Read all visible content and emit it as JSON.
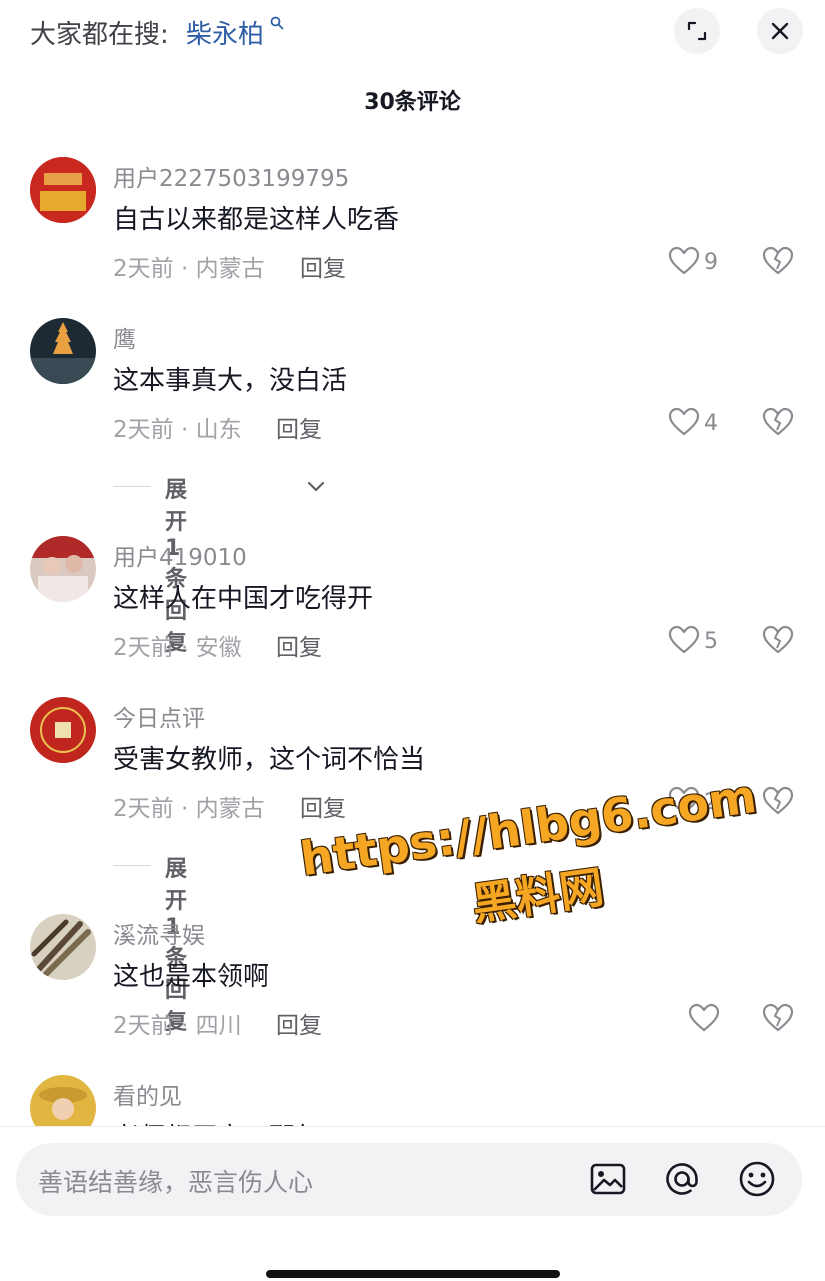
{
  "header": {
    "search_prefix": "大家都在搜:",
    "search_term": "柴永柏",
    "title": "30条评论"
  },
  "comments": [
    {
      "username": "用户2227503199795",
      "text": "自古以来都是这样人吃香",
      "meta": "2天前 · 内蒙古",
      "reply": "回复",
      "likes": "9",
      "avatar_color": "#c8281e"
    },
    {
      "username": "鹰",
      "text": "这本事真大，没白活",
      "meta": "2天前 · 山东",
      "reply": "回复",
      "likes": "4",
      "avatar_color": "#1e2a33",
      "expand": "展开1条回复"
    },
    {
      "username": "用户419010",
      "text": "这样人在中国才吃得开",
      "meta": "2天前 · 安徽",
      "reply": "回复",
      "likes": "5",
      "avatar_color": "#d9c9c0"
    },
    {
      "username": "今日点评",
      "text": "受害女教师，这个词不恰当",
      "meta": "2天前 · 内蒙古",
      "reply": "回复",
      "likes": "2",
      "avatar_color": "#c0261e",
      "expand": "展开1条回复"
    },
    {
      "username": "溪流寻娱",
      "text": "这也是本领啊",
      "meta": "2天前 · 四川",
      "reply": "回复",
      "likes": "",
      "avatar_color": "#6b5a45"
    },
    {
      "username": "看的见",
      "text": "老师都厉害，那年*",
      "meta": "",
      "reply": "",
      "likes": "",
      "avatar_color": "#e0b640"
    }
  ],
  "input": {
    "placeholder": "善语结善缘，恶言伤人心"
  },
  "watermark": {
    "line1": "https://hlbg6.com",
    "line2": "黑料网",
    "color": "#f5a623"
  }
}
